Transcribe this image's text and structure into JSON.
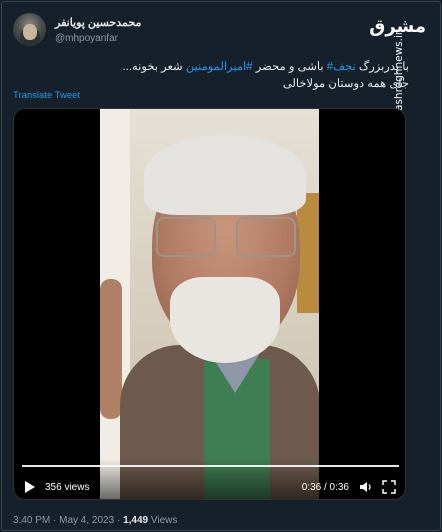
{
  "user": {
    "display_name": "محمدحسین پویانفر",
    "handle": "@mhpoyanfar"
  },
  "watermark": {
    "logo": "مشرق",
    "url": "mashreghnews.ir"
  },
  "tweet": {
    "part1": "با پدربزرگ ",
    "hashtag1": "نجف#",
    "part2": " باشی و محضر ",
    "hashtag2": "#امیرالمومنین",
    "part3": " شعر بخونه...",
    "line2": "جای همه دوستان مولاخالی"
  },
  "translate_label": "Translate Tweet",
  "video": {
    "views": "356 views",
    "time": "0:36 / 0:36",
    "progress": 1.0
  },
  "meta": {
    "time": "3:40 PM",
    "date": "May 4, 2023",
    "views_count": "1,449",
    "views_label": "Views"
  },
  "icons": {
    "play": "play-icon",
    "volume": "volume-icon",
    "fullscreen": "fullscreen-icon"
  }
}
